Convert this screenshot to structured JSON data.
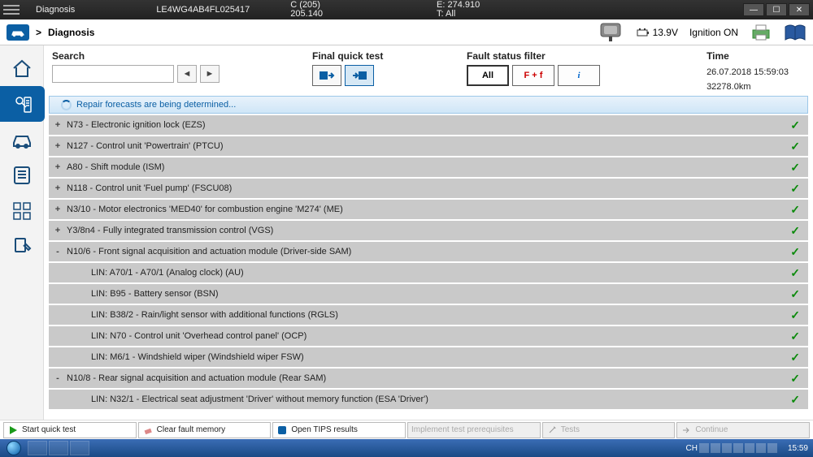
{
  "titlebar": {
    "app": "Diagnosis",
    "vin": "LE4WG4AB4FL025417",
    "model_c": "C (205)",
    "model_code": "205.140",
    "engine": "E: 274.910",
    "trans": "T: All"
  },
  "statusbar": {
    "breadcrumb_sep": ">",
    "breadcrumb": "Diagnosis",
    "voltage": "13.9V",
    "ignition": "Ignition ON"
  },
  "filters": {
    "search_label": "Search",
    "search_value": "",
    "quick_test_label": "Final quick test",
    "fault_filter_label": "Fault status filter",
    "btn_all": "All",
    "btn_ff": "F + f",
    "btn_info": "i",
    "time_label": "Time",
    "time_value": "26.07.2018 15:59:03",
    "odometer": "32278.0km"
  },
  "loading_msg": "Repair forecasts are being determined...",
  "rows": [
    {
      "indent": 0,
      "exp": "+",
      "text": "N73 - Electronic ignition lock (EZS)",
      "ok": true
    },
    {
      "indent": 0,
      "exp": "+",
      "text": "N127 - Control unit 'Powertrain' (PTCU)",
      "ok": true
    },
    {
      "indent": 0,
      "exp": "+",
      "text": "A80 - Shift module (ISM)",
      "ok": true
    },
    {
      "indent": 0,
      "exp": "+",
      "text": "N118 - Control unit 'Fuel pump' (FSCU08)",
      "ok": true
    },
    {
      "indent": 0,
      "exp": "+",
      "text": "N3/10 - Motor electronics 'MED40' for combustion engine 'M274' (ME)",
      "ok": true
    },
    {
      "indent": 0,
      "exp": "+",
      "text": "Y3/8n4 - Fully integrated transmission control (VGS)",
      "ok": true
    },
    {
      "indent": 0,
      "exp": "-",
      "text": "N10/6 - Front signal acquisition and actuation module (Driver-side SAM)",
      "ok": true
    },
    {
      "indent": 1,
      "exp": "",
      "text": "LIN: A70/1 - A70/1 (Analog clock) (AU)",
      "ok": true
    },
    {
      "indent": 1,
      "exp": "",
      "text": "LIN: B95 - Battery sensor (BSN)",
      "ok": true
    },
    {
      "indent": 1,
      "exp": "",
      "text": "LIN: B38/2 - Rain/light sensor with additional functions (RGLS)",
      "ok": true
    },
    {
      "indent": 1,
      "exp": "",
      "text": "LIN: N70 - Control unit 'Overhead control panel' (OCP)",
      "ok": true
    },
    {
      "indent": 1,
      "exp": "",
      "text": "LIN: M6/1 - Windshield wiper (Windshield wiper FSW)",
      "ok": true
    },
    {
      "indent": 0,
      "exp": "-",
      "text": "N10/8 - Rear signal acquisition and actuation module (Rear SAM)",
      "ok": true
    },
    {
      "indent": 1,
      "exp": "",
      "text": "LIN: N32/1 - Electrical seat adjustment 'Driver' without memory function (ESA 'Driver')",
      "ok": true
    }
  ],
  "actions": {
    "start_quick": "Start quick test",
    "clear_fault": "Clear fault memory",
    "open_tips": "Open TIPS results",
    "impl_prereq": "Implement test prerequisites",
    "tests": "Tests",
    "continue": "Continue"
  },
  "taskbar": {
    "lang": "CH",
    "clock": "15:59"
  }
}
